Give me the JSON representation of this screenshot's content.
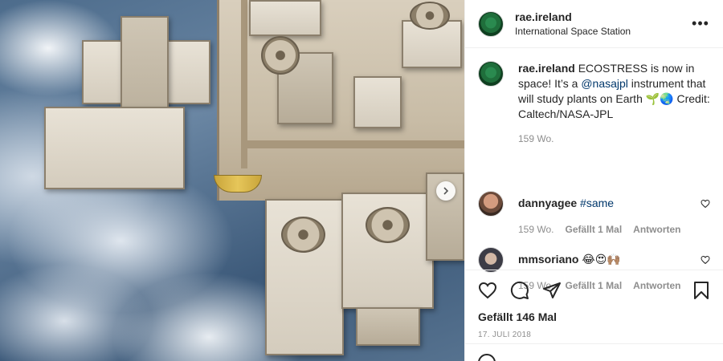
{
  "post": {
    "username": "rae.ireland",
    "location": "International Space Station"
  },
  "caption": {
    "username": "rae.ireland",
    "text_before": " ECOSTRESS is now in space! It’s a ",
    "mention": "@nasajpl",
    "text_after": " instrument that will study plants on Earth 🌱🌏 Credit: Caltech/NASA-JPL",
    "time": "159 Wo."
  },
  "comments": [
    {
      "username": "dannyagee",
      "text": "#same",
      "time": "159 Wo.",
      "likes": "Gefällt 1 Mal",
      "reply": "Antworten"
    },
    {
      "username": "mmsoriano",
      "text": "😂😍🙌🏽",
      "time": "159 Wo.",
      "likes": "Gefällt 1 Mal",
      "reply": "Antworten"
    }
  ],
  "likes_label": "Gefällt 146 Mal",
  "date": "17. JULI 2018",
  "icons": {
    "more": "more-options-icon",
    "like": "heart-icon",
    "comment": "comment-icon",
    "share": "share-icon",
    "save": "bookmark-icon",
    "next": "chevron-right-icon",
    "emoji": "emoji-icon"
  },
  "colors": {
    "text": "#262626",
    "muted": "#8e8e8e",
    "mention": "#00376b",
    "border": "#efefef"
  }
}
